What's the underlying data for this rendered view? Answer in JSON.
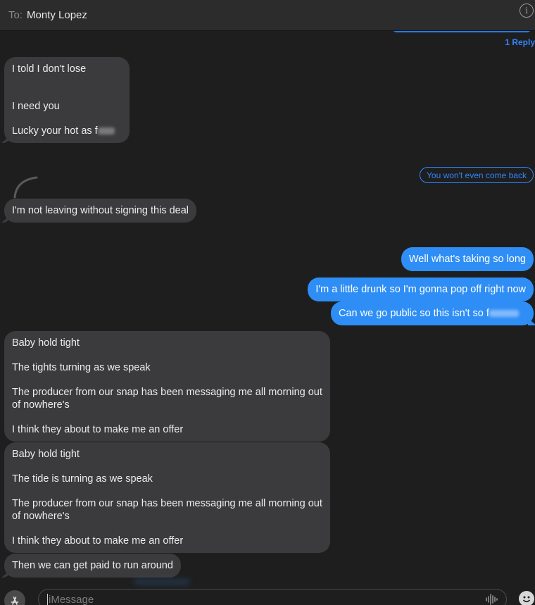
{
  "header": {
    "to_label": "To:",
    "recipient": "Monty Lopez",
    "info_icon": "info-icon"
  },
  "thread": {
    "reply_count": "1 Reply",
    "reply_quote": "You won't even come back"
  },
  "messages": [
    {
      "direction": "incoming",
      "lines": [
        "I told I don't lose",
        "I need you",
        "Lucky your hot as f"
      ]
    },
    {
      "direction": "incoming",
      "lines": [
        "I'm not leaving without signing this deal"
      ]
    },
    {
      "direction": "outgoing",
      "lines": [
        "Well what's taking so long"
      ]
    },
    {
      "direction": "outgoing",
      "lines": [
        "I'm a little drunk so I'm gonna pop off right now"
      ]
    },
    {
      "direction": "outgoing",
      "lines": [
        "Can we go public so this isn't so f"
      ]
    },
    {
      "direction": "incoming",
      "lines": [
        "Baby hold tight",
        "The tights turning as we speak",
        "The producer from our snap has been messaging me all morning out of nowhere's",
        "I think they about to make me an offer"
      ]
    },
    {
      "direction": "incoming",
      "lines": [
        "Baby hold tight",
        "The tide is turning as we speak",
        "The producer from our snap has been messaging me all morning out of nowhere's",
        "I think they about to make me an offer"
      ]
    },
    {
      "direction": "incoming",
      "lines": [
        "Then we can get paid to run around"
      ]
    }
  ],
  "composer": {
    "placeholder": "iMessage",
    "appstore_icon": "app-store-icon",
    "audio_icon": "audio-waveform-icon",
    "emoji_icon": "emoji-icon"
  },
  "colors": {
    "background": "#1e1e1e",
    "incoming_bubble": "#3b3b3d",
    "outgoing_bubble": "#2e8ef5",
    "accent": "#2f86ff"
  }
}
